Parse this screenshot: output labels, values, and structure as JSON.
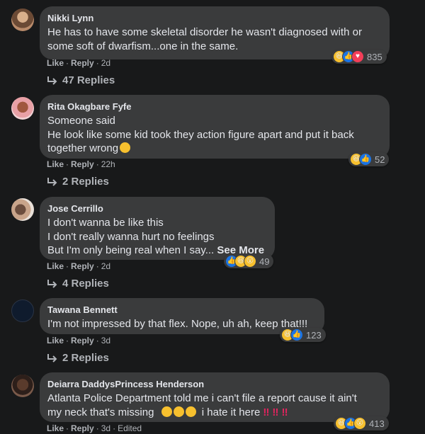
{
  "comments": [
    {
      "author": "Nikki Lynn",
      "lines": [
        "He has to have some skeletal disorder he wasn't diagnosed with or",
        "some soft of dwarfism...one in the same."
      ],
      "reaction_count": "835",
      "reactions": [
        "haha",
        "like",
        "love"
      ],
      "like": "Like",
      "reply": "Reply",
      "time": "2d",
      "edited": "",
      "replies": "47 Replies"
    },
    {
      "author": "Rita Okagbare Fyfe",
      "lines": [
        "Someone said",
        "He look like some kid took they action figure apart and put it back",
        "together wrong"
      ],
      "reaction_count": "52",
      "reactions": [
        "haha",
        "like"
      ],
      "like": "Like",
      "reply": "Reply",
      "time": "22h",
      "replies": "2 Replies"
    },
    {
      "author": "Jose Cerrillo",
      "lines": [
        "I don't wanna be like this",
        "I don't really wanna hurt no feelings",
        "But I'm only being real when I say..."
      ],
      "see_more": "See More",
      "reaction_count": "49",
      "reactions": [
        "like",
        "haha",
        "wow"
      ],
      "like": "Like",
      "reply": "Reply",
      "time": "2d",
      "replies": "4 Replies"
    },
    {
      "author": "Tawana Bennett",
      "lines": [
        "I'm not impressed by that flex. Nope, uh ah, keep that!!!"
      ],
      "reaction_count": "123",
      "reactions": [
        "haha",
        "like"
      ],
      "like": "Like",
      "reply": "Reply",
      "time": "3d",
      "replies": "2 Replies"
    },
    {
      "author": "Deiarra DaddysPrincess Henderson",
      "lines": [
        "Atlanta Police Department told me i can't file a report cause it ain't",
        "my neck that's missing",
        "i hate it here"
      ],
      "reaction_count": "413",
      "reactions": [
        "haha",
        "like",
        "wow"
      ],
      "like": "Like",
      "reply": "Reply",
      "time": "3d",
      "edited": "Edited"
    }
  ],
  "colors": {
    "background": "#18191a",
    "bubble": "#3a3b3c",
    "text": "#e4e6eb",
    "secondary": "#b0b3b8",
    "like_blue": "#1b74e4",
    "love_red": "#f33e58",
    "emoji_yellow": "#f7c02e"
  }
}
